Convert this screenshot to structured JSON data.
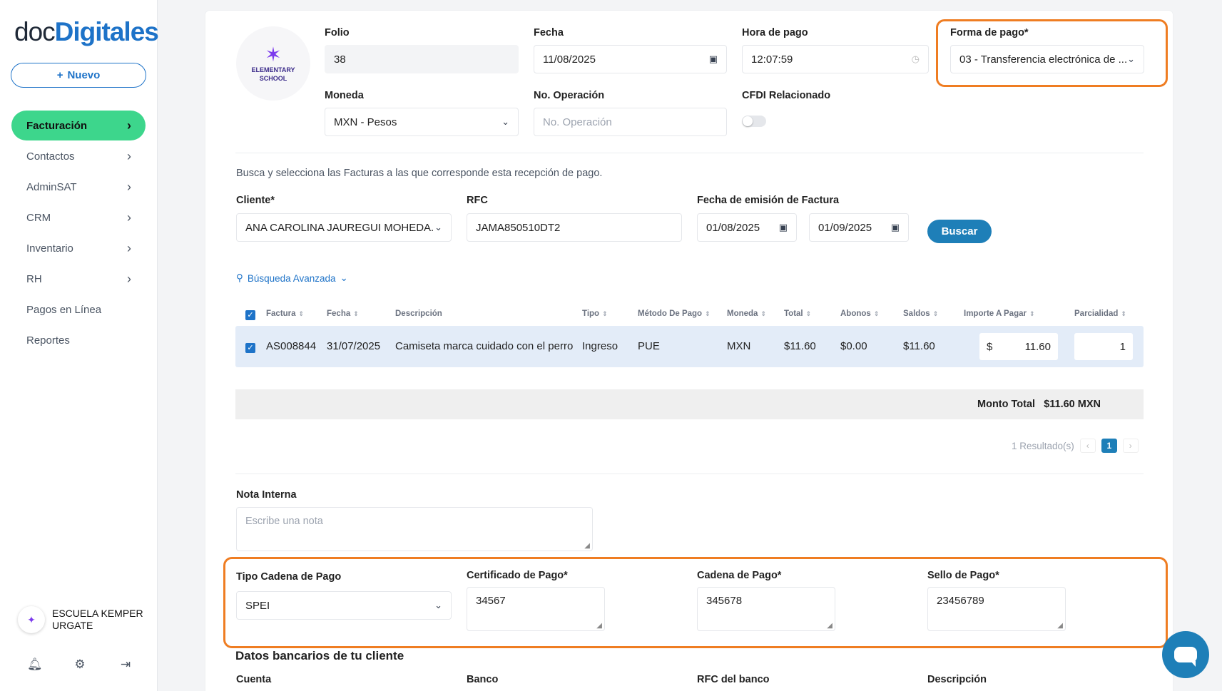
{
  "sidebar": {
    "logo_part1": "doc",
    "logo_part2": "Digitales",
    "new_button": "Nuevo",
    "items": [
      {
        "label": "Facturación",
        "chevron": true
      },
      {
        "label": "Contactos",
        "chevron": true
      },
      {
        "label": "AdminSAT",
        "chevron": true
      },
      {
        "label": "CRM",
        "chevron": true
      },
      {
        "label": "Inventario",
        "chevron": true
      },
      {
        "label": "RH",
        "chevron": true
      },
      {
        "label": "Pagos en Línea",
        "chevron": false
      },
      {
        "label": "Reportes",
        "chevron": false
      }
    ],
    "account_line1": "ESCUELA KEMPER",
    "account_line2": "URGATE"
  },
  "school_logo": {
    "line1": "ELEMENTARY",
    "line2": "SCHOOL"
  },
  "form": {
    "folio_label": "Folio",
    "folio_value": "38",
    "fecha_label": "Fecha",
    "fecha_value": "11/08/2025",
    "hora_label": "Hora de pago",
    "hora_value": "12:07:59",
    "forma_label": "Forma de pago*",
    "forma_value": "03 - Transferencia electrónica de ...",
    "moneda_label": "Moneda",
    "moneda_value": "MXN - Pesos",
    "operacion_label": "No. Operación",
    "operacion_placeholder": "No. Operación",
    "cfdi_label": "CFDI Relacionado",
    "cfdi_enabled": false
  },
  "search": {
    "hint": "Busca y selecciona las Facturas a las que corresponde esta recepción de pago.",
    "cliente_label": "Cliente*",
    "cliente_value": "ANA CAROLINA JAUREGUI MOHEDA...",
    "rfc_label": "RFC",
    "rfc_value": "JAMA850510DT2",
    "fecha_emision_label": "Fecha de emisión de Factura",
    "fecha_desde": "01/08/2025",
    "fecha_hasta": "01/09/2025",
    "buscar_button": "Buscar",
    "advanced_label": "Búsqueda Avanzada"
  },
  "table": {
    "headers": [
      "Factura",
      "Fecha",
      "Descripción",
      "Tipo",
      "Método De Pago",
      "Moneda",
      "Total",
      "Abonos",
      "Saldos",
      "Importe A Pagar",
      "Parcialidad"
    ],
    "rows": [
      {
        "factura": "AS008844",
        "fecha": "31/07/2025",
        "descripcion": "Camiseta marca cuidado con el perro",
        "tipo": "Ingreso",
        "metodo": "PUE",
        "moneda": "MXN",
        "total": "$11.60",
        "abonos": "$0.00",
        "saldos": "$11.60",
        "importe_currency": "$",
        "importe": "11.60",
        "parcialidad": "1",
        "selected": true
      }
    ],
    "monto_total_label": "Monto Total",
    "monto_total_value": "$11.60 MXN",
    "results_text": "1 Resultado(s)",
    "current_page": "1"
  },
  "nota": {
    "label": "Nota Interna",
    "placeholder": "Escribe una nota"
  },
  "pago": {
    "tipo_label": "Tipo Cadena de Pago",
    "tipo_value": "SPEI",
    "certificado_label": "Certificado de Pago*",
    "certificado_value": "34567",
    "cadena_label": "Cadena de Pago*",
    "cadena_value": "345678",
    "sello_label": "Sello de Pago*",
    "sello_value": "23456789"
  },
  "bank": {
    "title": "Datos bancarios de tu cliente",
    "cuenta_label": "Cuenta",
    "banco_label": "Banco",
    "rfc_banco_label": "RFC del banco",
    "descripcion_label": "Descripción"
  },
  "colors": {
    "accent": "#1e73c8",
    "active_nav": "#3dd68c",
    "highlight": "#ef7d22"
  }
}
